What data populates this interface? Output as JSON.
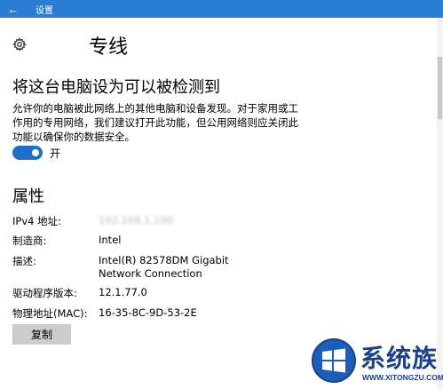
{
  "window": {
    "title": "设置"
  },
  "header": {
    "title": "专线"
  },
  "discoverable": {
    "heading": "将这台电脑设为可以被检测到",
    "description": "允许你的电脑被此网络上的其他电脑和设备发现。对于家用或工作用的专用网络，我们建议打开此功能，但公用网络则应关闭此功能以确保你的数据安全。",
    "toggle": {
      "state": "on",
      "label": "开",
      "accent": "#1e6fc8"
    }
  },
  "properties": {
    "heading": "属性",
    "items": [
      {
        "label": "IPv4 地址:",
        "value": "192.168.1.100"
      },
      {
        "label": "制造商:",
        "value": "Intel"
      },
      {
        "label": "描述:",
        "value": "Intel(R) 82578DM Gigabit Network Connection"
      },
      {
        "label": "驱动程序版本:",
        "value": "12.1.77.0"
      },
      {
        "label": "物理地址(MAC):",
        "value": "16-35-8C-9D-53-2E"
      }
    ],
    "copy_label": "复制"
  },
  "watermark": {
    "brand": "系统族",
    "url": "WWW.XITONGZU.COM"
  },
  "colors": {
    "titlebar": "#2b7cd3",
    "accent": "#1e6fc8",
    "button": "#cccccc"
  }
}
